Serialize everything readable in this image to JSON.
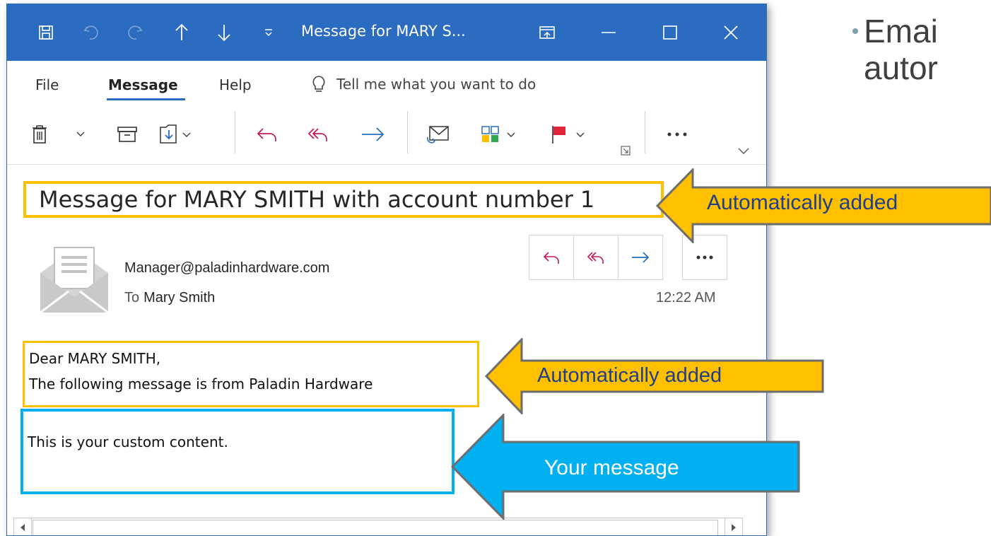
{
  "window": {
    "title": "Message for MARY S...",
    "menu": {
      "file": "File",
      "message": "Message",
      "help": "Help",
      "tell_me": "Tell me what you want to do"
    }
  },
  "message": {
    "subject": "Message for MARY SMITH with account number 1",
    "sender": "Manager@paladinhardware.com",
    "to_label": "To",
    "to_name": "Mary Smith",
    "time": "12:22 AM",
    "body_greeting": "Dear MARY SMITH,",
    "body_line2": "The following message is from Paladin Hardware",
    "body_custom": "This is your custom content."
  },
  "callouts": {
    "subject_label": "Automatically  added",
    "body_label": "Automatically  added",
    "custom_label": "Your message"
  },
  "slide": {
    "line1": "Emai",
    "line2": "autor"
  },
  "colors": {
    "titlebar": "#2b6bc0",
    "highlight_yellow": "#ffc000",
    "highlight_blue": "#00b0f0",
    "arrow_border": "#6d6d6d"
  },
  "icons": [
    "save-icon",
    "undo-icon",
    "redo-icon",
    "up-arrow-icon",
    "down-arrow-icon",
    "customize-icon",
    "restore-icon",
    "minimize-icon",
    "maximize-icon",
    "close-icon",
    "lightbulb-icon",
    "delete-icon",
    "archive-icon",
    "move-icon",
    "reply-icon",
    "reply-all-icon",
    "forward-icon",
    "read-unread-icon",
    "categorize-icon",
    "flag-icon",
    "more-icon",
    "envelope-avatar-icon"
  ]
}
